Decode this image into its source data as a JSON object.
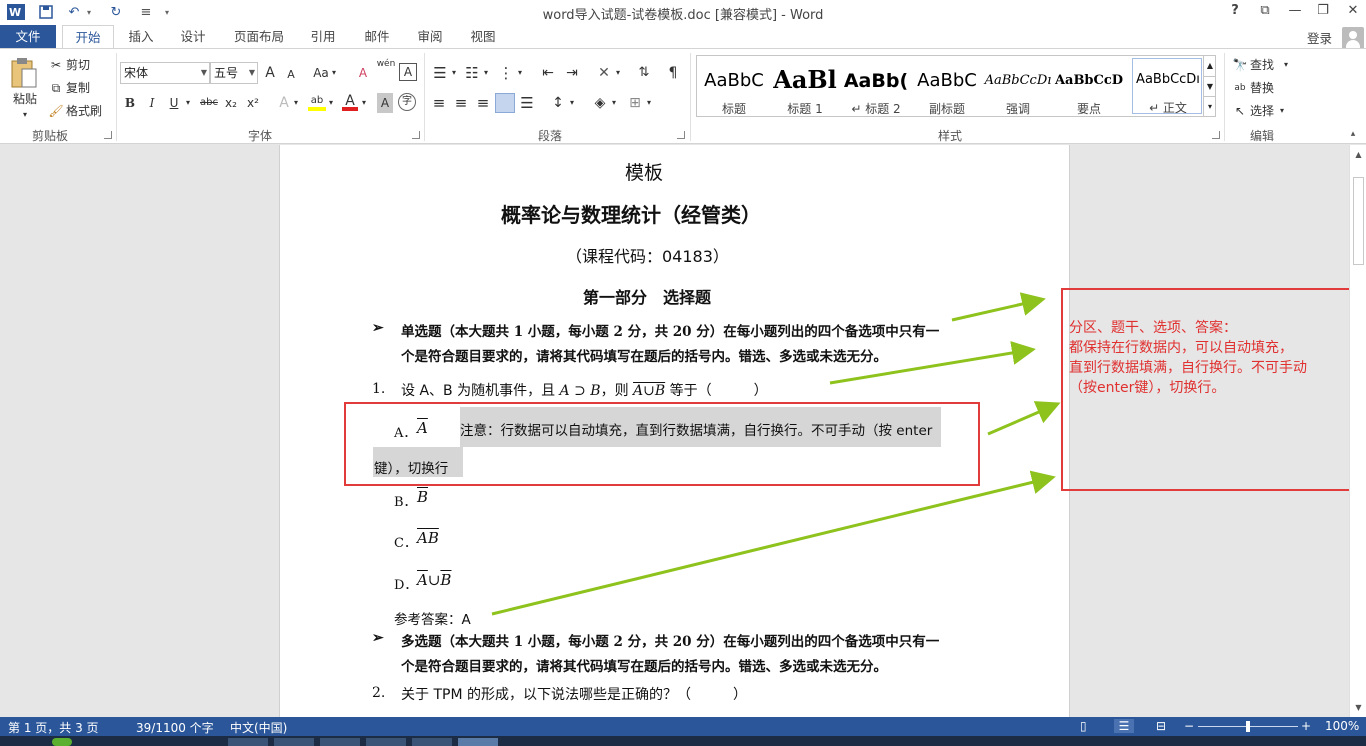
{
  "app": {
    "title": "word导入试题-试卷模板.doc [兼容模式] - Word",
    "help": "?",
    "login": "登录"
  },
  "tabs": [
    "文件",
    "开始",
    "插入",
    "设计",
    "页面布局",
    "引用",
    "邮件",
    "审阅",
    "视图"
  ],
  "ribbon": {
    "clipboard": {
      "paste": "粘贴",
      "cut": "剪切",
      "copy": "复制",
      "format_painter": "格式刷",
      "label": "剪贴板"
    },
    "font": {
      "name": "宋体",
      "size": "五号",
      "label": "字体",
      "grow": "A",
      "shrink": "A",
      "case": "Aa",
      "clear": "A",
      "phonetic": "wén",
      "border": "A",
      "bold": "B",
      "italic": "I",
      "underline": "U",
      "strike": "abc",
      "sub": "x₂",
      "sup": "x²",
      "effect": "A",
      "highlight": "ab",
      "color": "A",
      "shade": "A",
      "enclose": "字"
    },
    "paragraph": {
      "label": "段落"
    },
    "styles": {
      "label": "样式",
      "items": [
        {
          "sample": "AaBbC",
          "name": "标题"
        },
        {
          "sample": "AaBl",
          "name": "标题 1"
        },
        {
          "sample": "AaBb(",
          "name": "↵ 标题 2"
        },
        {
          "sample": "AaBbC",
          "name": "副标题"
        },
        {
          "sample": "AaBbCcDı",
          "name": "强调"
        },
        {
          "sample": "AaBbCcD",
          "name": "要点"
        },
        {
          "sample": "AaBbCcDı",
          "name": "↵ 正文"
        }
      ]
    },
    "editing": {
      "find": "查找",
      "replace": "替换",
      "select": "选择",
      "label": "编辑"
    }
  },
  "doc": {
    "line_template": "模板",
    "line_title": "概率论与数理统计（经管类）",
    "line_code": "（课程代码：04183）",
    "line_part": "第一部分　选择题",
    "section1_l1": "单选题（本大题共 1 小题，每小题 2 分，共 20 分）在每小题列出的四个备选项中只有一",
    "section1_l2": "个是符合题目要求的，请将其代码填写在题后的括号内。错选、多选或未选无分。",
    "q1_num": "1.",
    "q1_text_a": "设 A、B 为随机事件，且",
    "q1_math1": "A ⊃ B",
    "q1_text_b": "，则",
    "q1_math2": "A∪B",
    "q1_text_c": "等于（　　　）",
    "optA_label": "A．",
    "optA_math": "A",
    "note_l1": "注意：行数据可以自动填充，直到行数据填满，自行换行。不可手动（按 enter",
    "note_l2": "键），切换行",
    "optB_label": "B．",
    "optB_math": "B",
    "optC_label": "C．",
    "optC_math": "AB",
    "optD_label": "D．",
    "optD_math1": "A",
    "optD_union": "∪",
    "optD_math2": "B",
    "answer": "参考答案：A",
    "section2_l1": "多选题（本大题共 1 小题，每小题 2 分，共 20 分）在每小题列出的四个备选项中只有一",
    "section2_l2": "个是符合题目要求的，请将其代码填写在题后的括号内。错选、多选或未选无分。",
    "q2_num": "2.",
    "q2_text": "关于 TPM 的形成，以下说法哪些是正确的？（　　　）"
  },
  "annotation": {
    "line1": "分区、题干、选项、答案：",
    "line2": "都保持在行数据内，可以自动填充，",
    "line3": "直到行数据填满，自行换行。不可手动",
    "line4": "（按enter键），切换行。",
    "color": "#e03030",
    "arrow_color": "#8ec21c"
  },
  "status": {
    "page": "第 1 页，共 3 页",
    "words": "39/1100 个字",
    "lang": "中文(中国)",
    "zoom": "100%"
  }
}
